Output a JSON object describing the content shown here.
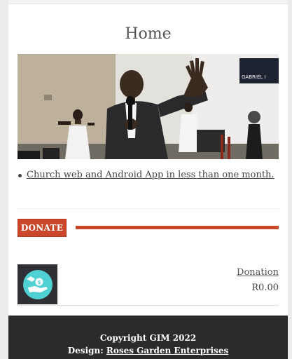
{
  "page": {
    "title": "Home"
  },
  "hero": {
    "sign_text": "GABRIEL I"
  },
  "content": {
    "bullets": [
      {
        "label": "Church web and Android App in less than one month."
      }
    ]
  },
  "donate_section": {
    "button_label": "DONATE",
    "accent_color": "#c9472b"
  },
  "product": {
    "name": "Donation",
    "price": "R0.00",
    "icon": "donate-hand-icon"
  },
  "footer": {
    "copyright": "Copyright GIM 2022",
    "design_prefix": "Design: ",
    "design_link": "Roses Garden Enterprises"
  }
}
